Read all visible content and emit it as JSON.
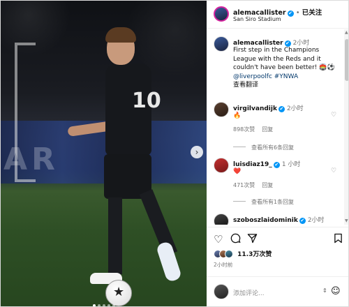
{
  "header": {
    "username": "alemacallister",
    "verified_mark": "✔",
    "separator": "•",
    "follow_state": "已关注",
    "location": "San Siro Stadium"
  },
  "caption": {
    "username": "alemacallister",
    "time": "2小时",
    "text": "First step in the Champions League with the Reds and it couldn't have been better! 🏟️⚽",
    "mention_and_tag": "@liverpoolfc #YNWA",
    "translate": "查看翻译"
  },
  "comments": [
    {
      "username": "virgilvandijk",
      "time": "2小时",
      "text": "🔥",
      "likes": "898次赞",
      "reply": "回复",
      "view_replies": "查看所有6条回复"
    },
    {
      "username": "luisdiaz19_",
      "time": "1 小时",
      "text": "❤️",
      "likes": "471次赞",
      "reply": "回复",
      "view_replies": "查看所有1条回复"
    },
    {
      "username": "szoboszlaidominik",
      "time": "2小时"
    }
  ],
  "actions": {
    "like_icon": "heart-icon",
    "comment_icon": "comment-icon",
    "share_icon": "share-icon",
    "save_icon": "bookmark-icon",
    "likes_count": "11.3万次赞",
    "posted_ago": "2小时前"
  },
  "compose": {
    "placeholder": "添加评论...",
    "emoji_icon": "smiley-icon",
    "sort_glyph": "⇕"
  },
  "media": {
    "ad_text": "AR",
    "jersey_number": "10",
    "next_arrow": "›",
    "slide_count": 5,
    "active_slide": 1
  }
}
